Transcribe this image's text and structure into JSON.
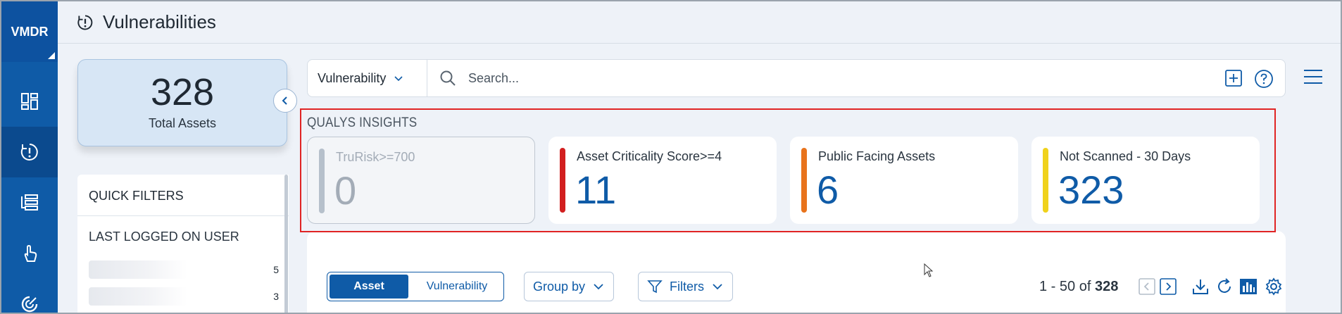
{
  "nav": {
    "logo": "VMDR",
    "items": [
      {
        "icon": "dashboard-icon"
      },
      {
        "icon": "vulnerabilities-icon",
        "active": true
      },
      {
        "icon": "prioritization-icon"
      },
      {
        "icon": "response-icon"
      },
      {
        "icon": "scan-icon"
      }
    ]
  },
  "header": {
    "title": "Vulnerabilities",
    "icon": "vulnerabilities-icon"
  },
  "summary": {
    "total": "328",
    "total_label": "Total Assets"
  },
  "quick_filters": {
    "title": "QUICK FILTERS",
    "section": "LAST LOGGED ON USER",
    "rows": [
      {
        "count": "5"
      },
      {
        "count": "3"
      }
    ]
  },
  "search": {
    "type_label": "Vulnerability",
    "placeholder": "Search..."
  },
  "insights": {
    "title": "QUALYS INSIGHTS",
    "cards": [
      {
        "label": "TruRisk>=700",
        "value": "0",
        "color": "#b6c0cb",
        "disabled": true
      },
      {
        "label": "Asset Criticality Score>=4",
        "value": "11",
        "color": "#d21f1f"
      },
      {
        "label": "Public Facing Assets",
        "value": "6",
        "color": "#e8731c"
      },
      {
        "label": "Not Scanned - 30 Days",
        "value": "323",
        "color": "#f0d21c"
      }
    ]
  },
  "results": {
    "tabs": {
      "active": "Asset",
      "inactive": "Vulnerability"
    },
    "group_by": "Group by",
    "filters": "Filters",
    "range": "1 - 50 of",
    "total": "328"
  },
  "colors": {
    "accent": "#0f5ba7",
    "highlight": "#e02424"
  }
}
